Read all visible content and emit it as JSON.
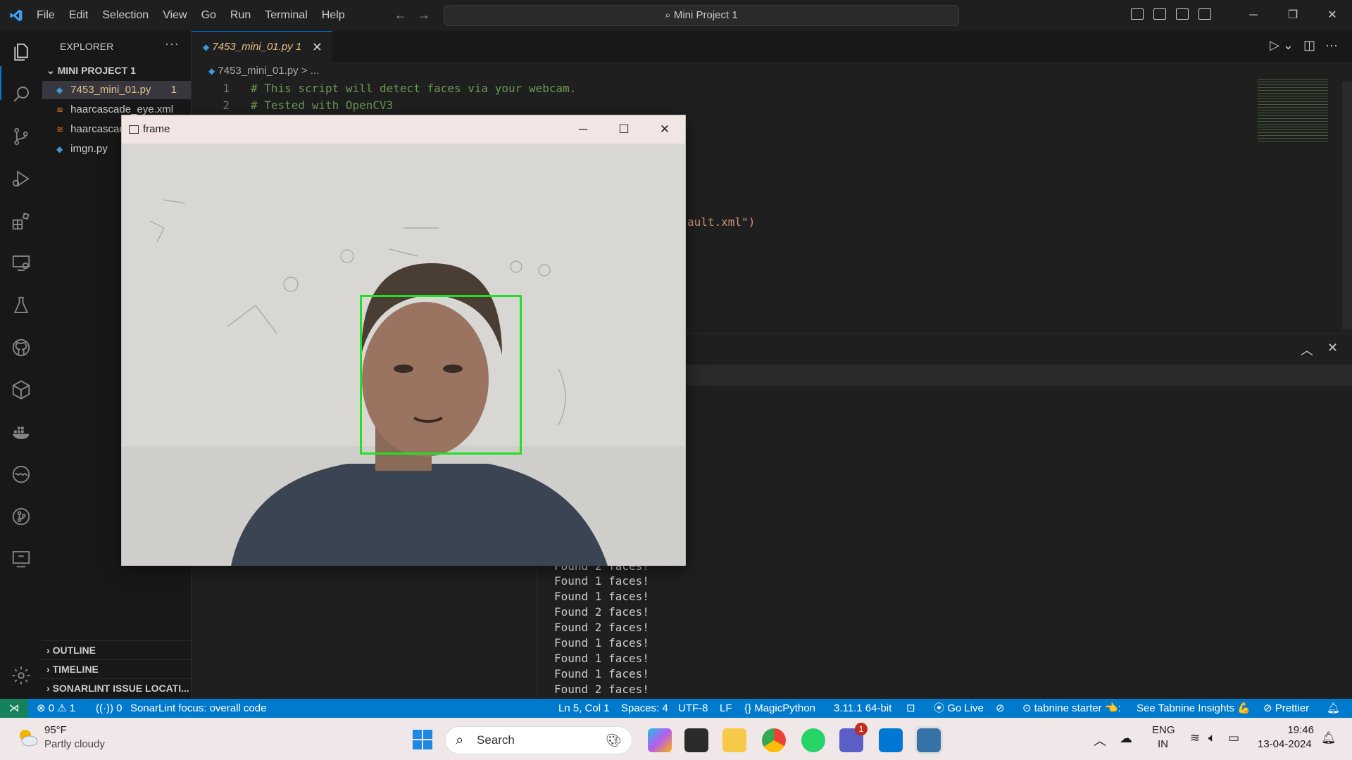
{
  "menu": [
    "File",
    "Edit",
    "Selection",
    "View",
    "Go",
    "Run",
    "Terminal",
    "Help"
  ],
  "command_center": "Mini Project 1",
  "explorer": {
    "title": "EXPLORER",
    "project": "MINI PROJECT 1",
    "files": [
      {
        "name": "7453_mini_01.py",
        "badge": "1"
      },
      {
        "name": "haarcascade_eye.xml"
      },
      {
        "name": "haarcascade_frontalface_default.xml"
      },
      {
        "name": "imgn.py"
      }
    ],
    "sections": [
      "OUTLINE",
      "TIMELINE",
      "SONARLINT ISSUE LOCATI..."
    ]
  },
  "tab": {
    "label": "7453_mini_01.py 1"
  },
  "breadcrumb": "7453_mini_01.py > ...",
  "code": {
    "line1": "# This script will detect faces via your webcam.",
    "line2": "# Tested with OpenCV3",
    "partial": "ault.xml\")"
  },
  "terminal": {
    "partial": "Found 2 faces!",
    "lines": [
      "Found 1 faces!",
      "Found 1 faces!",
      "Found 2 faces!",
      "Found 2 faces!",
      "Found 1 faces!",
      "Found 1 faces!",
      "Found 1 faces!",
      "Found 2 faces!"
    ]
  },
  "frame_window": {
    "title": "frame"
  },
  "status": {
    "problems": "⊗ 0 ⚠ 1",
    "ports": "0",
    "sonarlint": "SonarLint focus: overall code",
    "position": "Ln 5, Col 1",
    "spaces": "Spaces: 4",
    "encoding": "UTF-8",
    "eol": "LF",
    "language": "MagicPython",
    "interpreter": "3.11.1 64-bit",
    "golive": "Go Live",
    "tabnine": "tabnine starter 👈:",
    "tabnine_insights": "See Tabnine Insights 💪",
    "prettier": "Prettier"
  },
  "taskbar": {
    "weather_temp": "95°F",
    "weather_desc": "Partly cloudy",
    "search": "Search",
    "lang": "ENG",
    "region": "IN",
    "time": "19:46",
    "date": "13-04-2024",
    "teams_badge": "1"
  }
}
